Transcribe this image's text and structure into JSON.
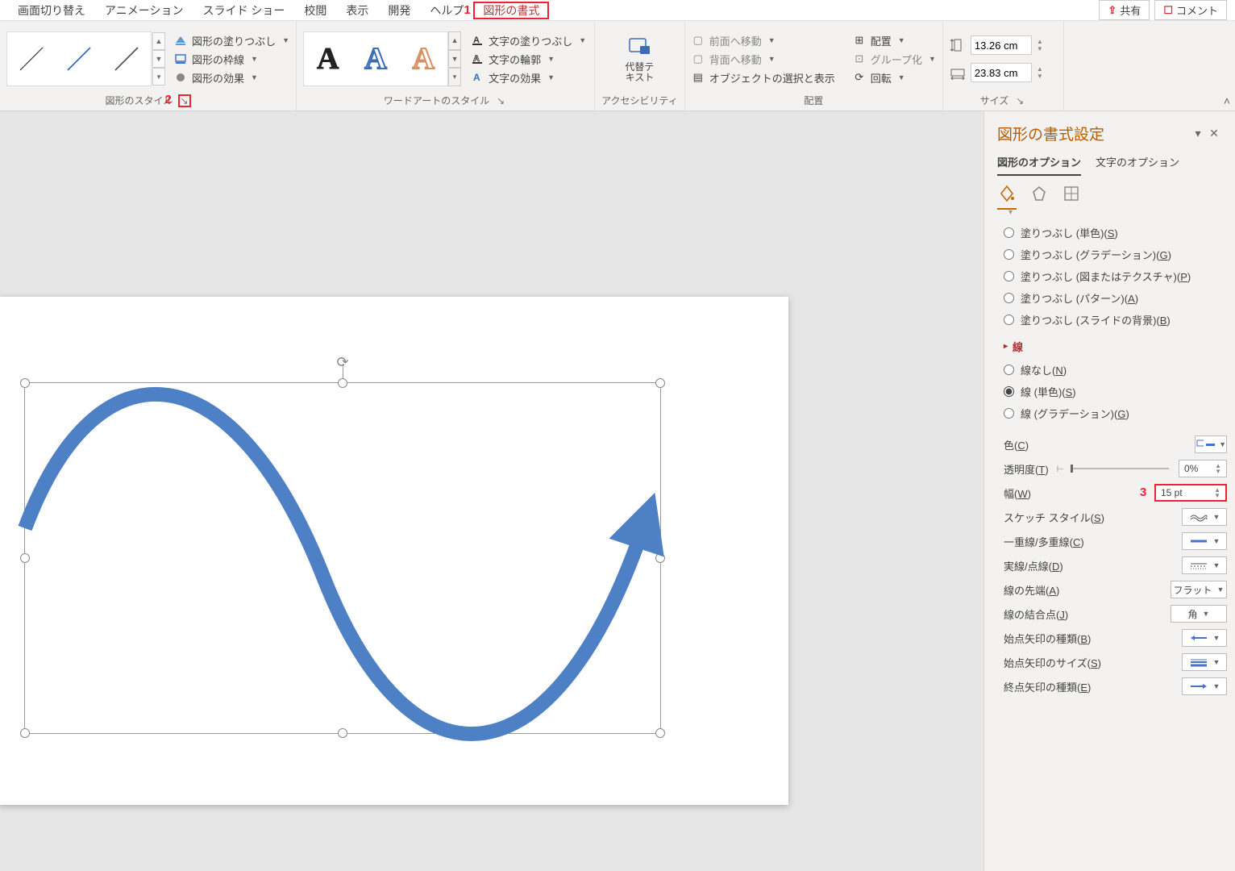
{
  "menu": {
    "items": [
      "画面切り替え",
      "アニメーション",
      "スライド ショー",
      "校閲",
      "表示",
      "開発",
      "ヘルプ",
      "図形の書式"
    ],
    "active_index": 7,
    "share": "共有",
    "comment": "コメント"
  },
  "callouts": {
    "n1": "1",
    "n2": "2",
    "n3": "3"
  },
  "ribbon": {
    "shape_style": {
      "fill": "図形の塗りつぶし",
      "outline": "図形の枠線",
      "effects": "図形の効果",
      "group_label": "図形のスタイル"
    },
    "wordart": {
      "fill": "文字の塗りつぶし",
      "outline": "文字の輪郭",
      "effects": "文字の効果",
      "group_label": "ワードアートのスタイル",
      "glyph": "A"
    },
    "access": {
      "alt_text_line1": "代替テ",
      "alt_text_line2": "キスト",
      "group_label": "アクセシビリティ"
    },
    "arrange": {
      "bring_forward": "前面へ移動",
      "send_backward": "背面へ移動",
      "selection_pane": "オブジェクトの選択と表示",
      "align": "配置",
      "group": "グループ化",
      "rotate": "回転",
      "group_label": "配置"
    },
    "size": {
      "height": "13.26 cm",
      "width": "23.83 cm",
      "group_label": "サイズ"
    }
  },
  "pane": {
    "title": "図形の書式設定",
    "tabs": {
      "shape": "図形のオプション",
      "text": "文字のオプション"
    },
    "fill_options": {
      "solid": {
        "label": "塗りつぶし (単色)",
        "mn": "S"
      },
      "gradient": {
        "label": "塗りつぶし (グラデーション)",
        "mn": "G"
      },
      "picture": {
        "label": "塗りつぶし (図またはテクスチャ)",
        "mn": "P"
      },
      "pattern": {
        "label": "塗りつぶし (パターン)",
        "mn": "A"
      },
      "slide_bg": {
        "label": "塗りつぶし (スライドの背景)",
        "mn": "B"
      }
    },
    "line_section": "線",
    "line_options": {
      "none": {
        "label": "線なし",
        "mn": "N"
      },
      "solid": {
        "label": "線 (単色)",
        "mn": "S"
      },
      "gradient": {
        "label": "線 (グラデーション)",
        "mn": "G"
      }
    },
    "props": {
      "color": {
        "label": "色",
        "mn": "C"
      },
      "transparency": {
        "label": "透明度",
        "mn": "T",
        "value": "0%"
      },
      "width": {
        "label": "幅",
        "mn": "W",
        "value": "15 pt"
      },
      "sketch": {
        "label": "スケッチ スタイル",
        "mn": "S"
      },
      "compound": {
        "label": "一重線/多重線",
        "mn": "C"
      },
      "dash": {
        "label": "実線/点線",
        "mn": "D"
      },
      "cap": {
        "label": "線の先端",
        "mn": "A",
        "value": "フラット"
      },
      "join": {
        "label": "線の結合点",
        "mn": "J",
        "value": "角"
      },
      "begin_type": {
        "label": "始点矢印の種類",
        "mn": "B"
      },
      "begin_size": {
        "label": "始点矢印のサイズ",
        "mn": "S"
      },
      "end_type": {
        "label": "終点矢印の種類",
        "mn": "E"
      }
    }
  },
  "colors": {
    "shape_blue": "#4e80c6",
    "highlight_red": "#e23"
  }
}
